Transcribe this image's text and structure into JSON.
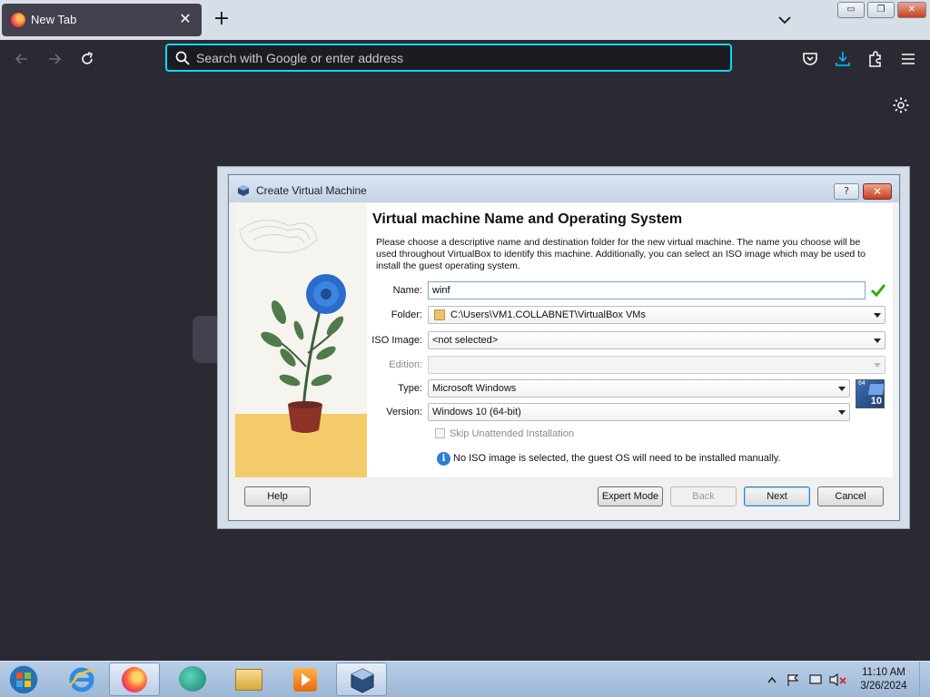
{
  "browser": {
    "tab_title": "New Tab",
    "tab_close": "✕",
    "new_tab": "+",
    "url_placeholder": "Search with Google or enter address",
    "url_value": ""
  },
  "window_controls": {
    "minimize": "▭",
    "restore": "❐",
    "close": "✕"
  },
  "dialog": {
    "title": "Create Virtual Machine",
    "help_button": "?",
    "close_button": "✕",
    "heading": "Virtual machine Name and Operating System",
    "description": "Please choose a descriptive name and destination folder for the new virtual machine. The name you choose will be used throughout VirtualBox to identify this machine. Additionally, you can select an ISO image which may be used to install the guest operating system.",
    "fields": {
      "name_label": "Name:",
      "name_value": "winf",
      "folder_label": "Folder:",
      "folder_value": "C:\\Users\\VM1.COLLABNET\\VirtualBox VMs",
      "iso_label": "ISO Image:",
      "iso_value": "<not selected>",
      "edition_label": "Edition:",
      "edition_value": "",
      "type_label": "Type:",
      "type_value": "Microsoft Windows",
      "version_label": "Version:",
      "version_value": "Windows 10 (64-bit)",
      "os_badge_bits": "64",
      "os_badge_version": "10"
    },
    "skip_unattended": "Skip Unattended Installation",
    "info_message": "No ISO image is selected, the guest OS will need to be installed manually.",
    "buttons": {
      "help": "Help",
      "expert": "Expert Mode",
      "back": "Back",
      "next": "Next",
      "cancel": "Cancel"
    }
  },
  "taskbar": {
    "time": "11:10 AM",
    "date": "3/26/2024"
  }
}
